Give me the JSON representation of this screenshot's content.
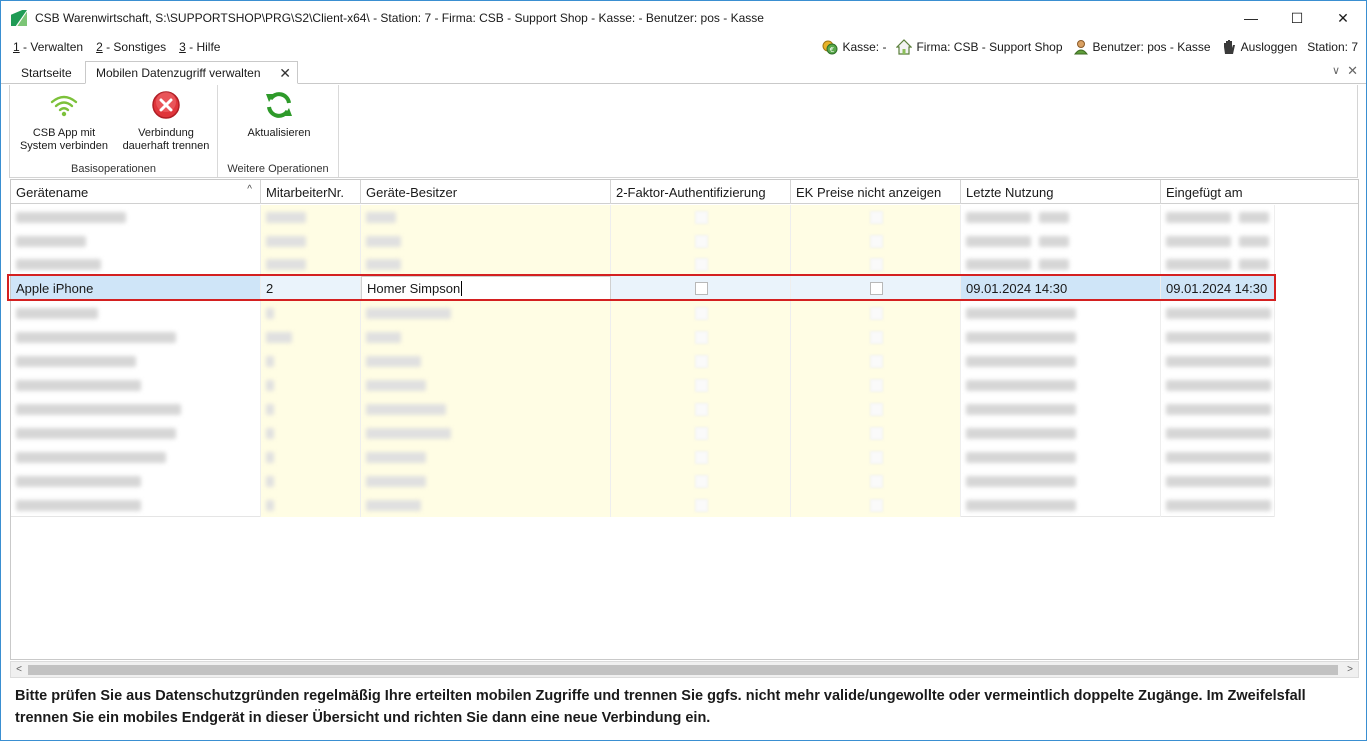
{
  "window": {
    "title": "CSB Warenwirtschaft, S:\\SUPPORTSHOP\\PRG\\S2\\Client-x64\\ - Station: 7 - Firma: CSB - Support Shop - Kasse:  - Benutzer: pos - Kasse",
    "minimize": "—",
    "maximize": "☐",
    "close": "✕"
  },
  "menu": {
    "items": [
      {
        "key": "1",
        "label": " - Verwalten"
      },
      {
        "key": "2",
        "label": " - Sonstiges"
      },
      {
        "key": "3",
        "label": " - Hilfe"
      }
    ]
  },
  "status": {
    "kasse": "Kasse: -",
    "firma": "Firma: CSB - Support Shop",
    "benutzer": "Benutzer: pos - Kasse",
    "ausloggen": "Ausloggen",
    "station": "Station: 7"
  },
  "tabs": {
    "home": "Startseite",
    "active": "Mobilen Datenzugriff verwalten",
    "close": "✕",
    "chevron": "∨",
    "close_all": "✕"
  },
  "ribbon": {
    "groups": [
      {
        "label": "Basisoperationen",
        "buttons": [
          {
            "line1": "CSB App mit",
            "line2": "System verbinden",
            "icon": "wifi-icon"
          },
          {
            "line1": "Verbindung",
            "line2": "dauerhaft trennen",
            "icon": "disconnect-icon"
          }
        ]
      },
      {
        "label": "Weitere Operationen",
        "buttons": [
          {
            "line1": "Aktualisieren",
            "line2": "",
            "icon": "refresh-icon"
          }
        ]
      }
    ]
  },
  "grid": {
    "columns": [
      "Gerätename",
      "MitarbeiterNr.",
      "Geräte-Besitzer",
      "2-Faktor-Authentifizierung",
      "EK Preise nicht anzeigen",
      "Letzte Nutzung",
      "Eingefügt am"
    ],
    "sort_indicator": "^",
    "selected_row": {
      "geraetename": "Apple iPhone",
      "mitarbeiternr": "2",
      "besitzer": "Homer Simpson",
      "zwei_faktor": false,
      "ek_preise": false,
      "letzte_nutzung": "09.01.2024 14:30",
      "eingefuegt_am": "09.01.2024 14:30"
    }
  },
  "scrollbar": {
    "left_arrow": "<",
    "right_arrow": ">"
  },
  "notice": "Bitte prüfen Sie aus Datenschutzgründen regelmäßig Ihre erteilten mobilen Zugriffe und trennen Sie ggfs. nicht mehr valide/ungewollte oder vermeintlich doppelte Zugänge. Im Zweifelsfall trennen Sie ein mobiles Endgerät in dieser Übersicht und richten Sie dann eine neue Verbindung ein."
}
